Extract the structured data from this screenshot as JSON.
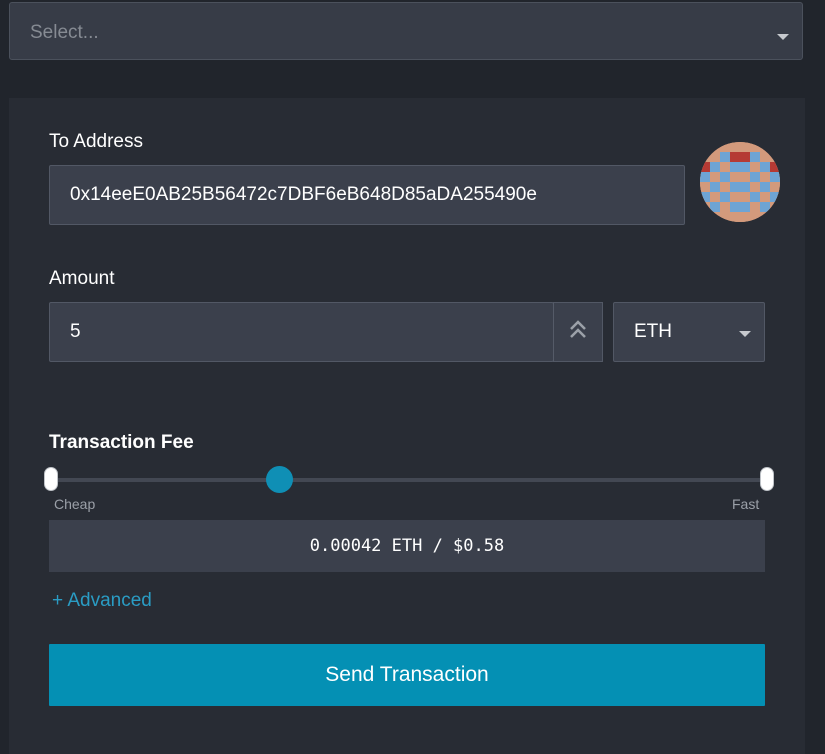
{
  "top_select": {
    "placeholder": "Select..."
  },
  "to_address": {
    "label": "To Address",
    "value": "0x14eeE0AB25B56472c7DBF6eB648D85aDA255490e"
  },
  "amount": {
    "label": "Amount",
    "value": "5",
    "currency": "ETH"
  },
  "transaction_fee": {
    "label": "Transaction Fee",
    "min_label": "Cheap",
    "max_label": "Fast",
    "value_text": "0.00042 ETH / $0.58"
  },
  "advanced_link": "+ Advanced",
  "send_button": "Send Transaction",
  "icons": {
    "select_caret": "chevron-down-icon",
    "double_up": "double-chevron-up-icon",
    "avatar": "identicon-avatar"
  },
  "colors": {
    "accent": "#0490b4",
    "link": "#2a9cc4",
    "background": "#21252c",
    "panel": "#282c34",
    "input": "#3b404c"
  }
}
